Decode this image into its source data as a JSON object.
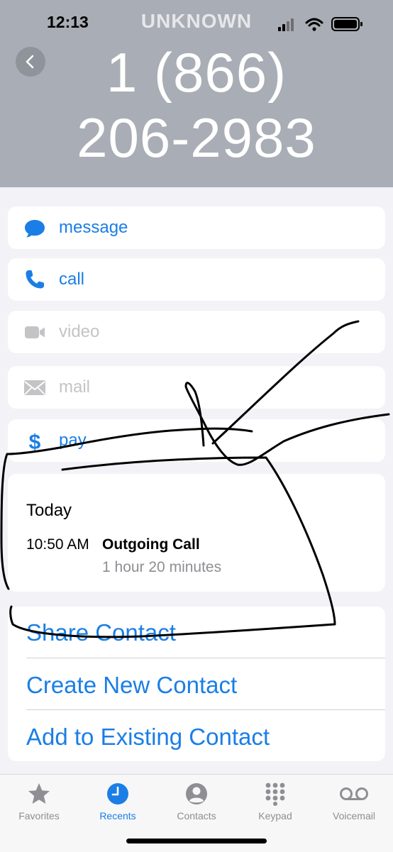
{
  "status_bar": {
    "time": "12:13",
    "carrier": "UNKNOWN"
  },
  "contact": {
    "number_line1": "1 (866)",
    "number_line2": "206-2983"
  },
  "actions": [
    {
      "label": "message",
      "icon": "message-icon",
      "enabled": true
    },
    {
      "label": "call",
      "icon": "phone-icon",
      "enabled": true
    },
    {
      "label": "video",
      "icon": "video-icon",
      "enabled": false
    },
    {
      "label": "mail",
      "icon": "mail-icon",
      "enabled": false
    },
    {
      "label": "pay",
      "icon": "dollar-icon",
      "enabled": true
    }
  ],
  "history": {
    "day": "Today",
    "time": "10:50 AM",
    "type": "Outgoing Call",
    "duration": "1 hour 20 minutes"
  },
  "links": [
    "Share Contact",
    "Create New Contact",
    "Add to Existing Contact"
  ],
  "tabs": [
    {
      "label": "Favorites",
      "icon": "star-icon"
    },
    {
      "label": "Recents",
      "icon": "clock-icon"
    },
    {
      "label": "Contacts",
      "icon": "person-icon"
    },
    {
      "label": "Keypad",
      "icon": "keypad-icon"
    },
    {
      "label": "Voicemail",
      "icon": "voicemail-icon"
    }
  ],
  "active_tab": "Recents",
  "colors": {
    "accent": "#1a7ee6",
    "header": "#a9adb5",
    "disabled": "#c4c4c7"
  }
}
